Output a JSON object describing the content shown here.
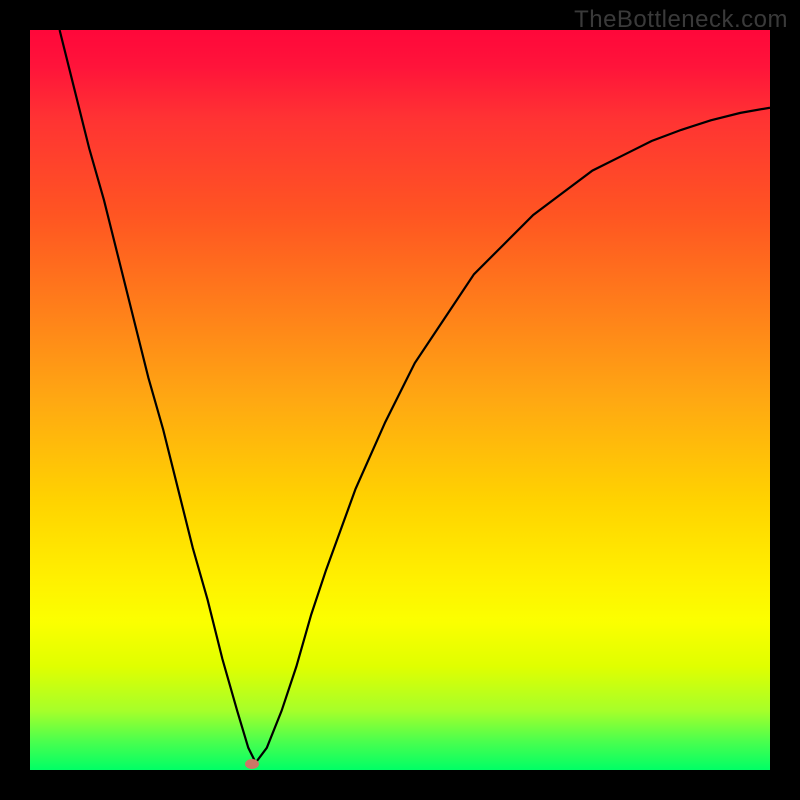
{
  "watermark": "TheBottleneck.com",
  "chart_data": {
    "type": "line",
    "title": "",
    "xlabel": "",
    "ylabel": "",
    "xlim": [
      0,
      100
    ],
    "ylim": [
      0,
      100
    ],
    "grid": false,
    "legend": false,
    "series": [
      {
        "name": "curve",
        "x": [
          4,
          6,
          8,
          10,
          12,
          14,
          16,
          18,
          20,
          22,
          24,
          26,
          28,
          29.5,
          30.5,
          32,
          34,
          36,
          38,
          40,
          44,
          48,
          52,
          56,
          60,
          64,
          68,
          72,
          76,
          80,
          84,
          88,
          92,
          96,
          100
        ],
        "y": [
          100,
          92,
          84,
          77,
          69,
          61,
          53,
          46,
          38,
          30,
          23,
          15,
          8,
          3,
          1,
          3,
          8,
          14,
          21,
          27,
          38,
          47,
          55,
          61,
          67,
          71,
          75,
          78,
          81,
          83,
          85,
          86.5,
          87.8,
          88.8,
          89.5
        ]
      }
    ],
    "marker": {
      "x": 30,
      "y": 0.8
    },
    "gradient": {
      "top": "#ff073a",
      "mid_upper": "#ff801a",
      "mid": "#ffd400",
      "mid_lower": "#fbff00",
      "bottom": "#00ff66"
    }
  }
}
